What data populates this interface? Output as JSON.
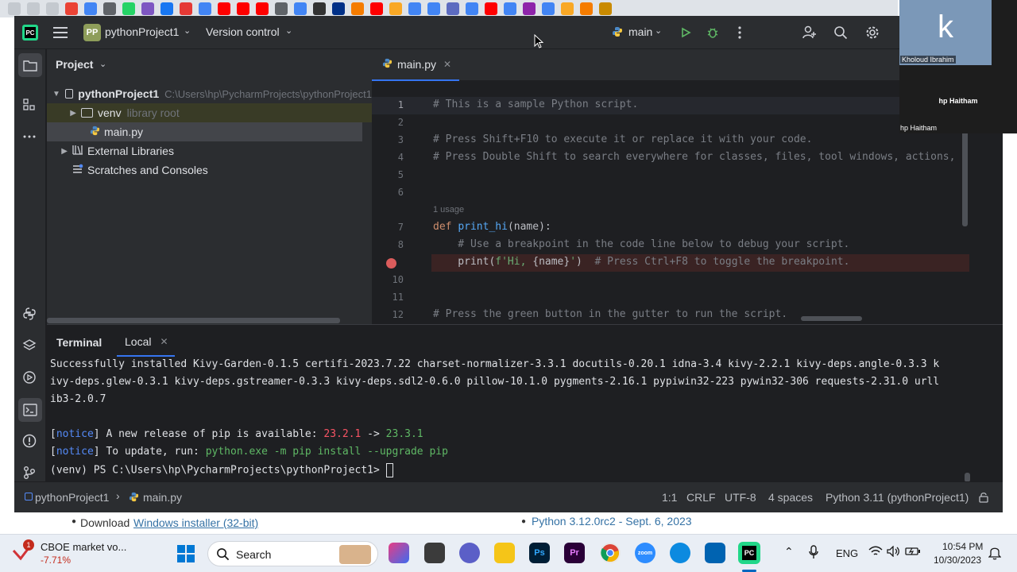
{
  "ide": {
    "logo": "PC",
    "project_badge": "PP",
    "project_name": "pythonProject1",
    "vcs_menu": "Version control",
    "branch": "main",
    "icons": {
      "hamburger": "menu-icon",
      "run": "run-icon",
      "debug": "debug-icon",
      "more": "more-vertical-icon",
      "account": "add-user-icon",
      "search": "search-icon",
      "settings": "gear-icon"
    }
  },
  "project_panel": {
    "title": "Project",
    "root_name": "pythonProject1",
    "root_path": "C:\\Users\\hp\\PycharmProjects\\pythonProject1",
    "venv": "venv",
    "venv_tag": "library root",
    "file": "main.py",
    "external": "External Libraries",
    "scratches": "Scratches and Consoles"
  },
  "editor": {
    "tab": "main.py",
    "usage_hint": "1 usage",
    "lines": [
      {
        "n": "1",
        "text": "# This is a sample Python script."
      },
      {
        "n": "2",
        "text": ""
      },
      {
        "n": "3",
        "text": "# Press Shift+F10 to execute it or replace it with your code."
      },
      {
        "n": "4",
        "text": "# Press Double Shift to search everywhere for classes, files, tool windows, actions,"
      },
      {
        "n": "5",
        "text": ""
      },
      {
        "n": "6",
        "text": ""
      },
      {
        "n": "7",
        "kw": "def ",
        "fn": "print_hi",
        "rest": "(name):"
      },
      {
        "n": "8",
        "text": "    # Use a breakpoint in the code line below to debug your script."
      },
      {
        "n": "9",
        "pre": "    print(",
        "str1": "f'Hi, ",
        "mid": "{name}",
        "str2": "'",
        "post": ")",
        "cmt": "  # Press Ctrl+F8 to toggle the breakpoint."
      },
      {
        "n": "10",
        "text": ""
      },
      {
        "n": "11",
        "text": ""
      },
      {
        "n": "12",
        "text": "# Press the green button in the gutter to run the script."
      }
    ]
  },
  "terminal": {
    "tab_title": "Terminal",
    "session_tab": "Local",
    "lines": [
      "Successfully installed Kivy-Garden-0.1.5 certifi-2023.7.22 charset-normalizer-3.3.1 docutils-0.20.1 idna-3.4 kivy-2.2.1 kivy-deps.angle-0.3.3 k",
      "ivy-deps.glew-0.3.1 kivy-deps.gstreamer-0.3.3 kivy-deps.sdl2-0.6.0 pillow-10.1.0 pygments-2.16.1 pypiwin32-223 pywin32-306 requests-2.31.0 urll",
      "ib3-2.0.7"
    ],
    "notice_tag": "notice",
    "notice1_text": " A new release of pip is available: ",
    "notice1_old": "23.2.1",
    "notice1_arrow": " -> ",
    "notice1_new": "23.3.1",
    "notice2_text": " To update, run: ",
    "notice2_cmd": "python.exe -m pip install --upgrade pip",
    "prompt": "(venv) PS C:\\Users\\hp\\PycharmProjects\\pythonProject1> "
  },
  "statusbar": {
    "crumb_project": "pythonProject1",
    "crumb_file": "main.py",
    "position": "1:1",
    "line_sep": "CRLF",
    "encoding": "UTF-8",
    "indent": "4 spaces",
    "interpreter": "Python 3.11 (pythonProject1)"
  },
  "video": {
    "tile1_letter": "k",
    "tile1_name": "Kholoud Ibrahim",
    "tile2_name": "hp Haitham",
    "tile2_caption": "hp Haitham"
  },
  "webpage": {
    "download_prefix": "Download ",
    "download_link": "Windows installer (32-bit)",
    "python_link": "Python 3.12.0rc2 - Sept. 6, 2023"
  },
  "taskbar": {
    "stock_name": "CBOE market vo...",
    "stock_change": "-7.71%",
    "stock_badge": "1",
    "search_placeholder": "Search",
    "lang": "ENG",
    "time": "10:54 PM",
    "date": "10/30/2023"
  },
  "colors": {
    "ide_bg": "#1e1f22",
    "panel_bg": "#2b2d30",
    "accent": "#3574f0",
    "breakpoint": "#db5c5c",
    "notice_blue": "#548af7",
    "old_version_red": "#f75464",
    "new_version_green": "#5fb865"
  }
}
